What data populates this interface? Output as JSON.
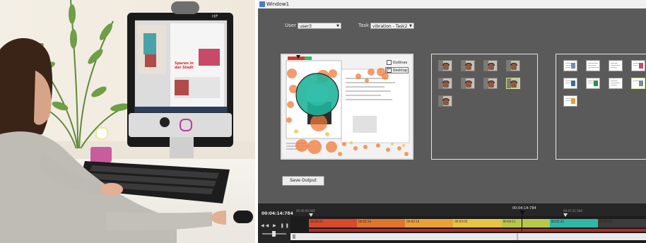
{
  "photo": {
    "monitor_brand": "HP",
    "screen_headline": "Sparen in der Stadt"
  },
  "window": {
    "title": "Window1"
  },
  "controls": {
    "user_label": "User",
    "user_value": "user3",
    "task_label": "Task",
    "task_value": "vibration - Task2"
  },
  "preview": {
    "checkbox_outlines": "Outlines",
    "checkbox_desktop": "Desktop",
    "outlines_checked": false,
    "desktop_checked": true
  },
  "save_button_label": "Save Output",
  "timeline": {
    "current_time": "00:04:14:784",
    "playhead_label": "00:04:14:784",
    "start_marker": "00:00:00:000",
    "end_marker": "00:07:21:504",
    "segment_labels": [
      "00:00:25",
      "00:01:14",
      "00:02:10",
      "00:03:05",
      "00:04:11",
      "00:05:20",
      "00:06:48"
    ],
    "segment_colors": [
      "#d64a2e",
      "#e0752f",
      "#e9a03a",
      "#e7c347",
      "#b7c84e",
      "#2eb8a6",
      "#3c3c3c"
    ],
    "transport": [
      "rewind",
      "play",
      "pause",
      "forward"
    ]
  },
  "icons": {
    "app_icon": "window-icon",
    "playhead": "triangle-marker-icon"
  }
}
